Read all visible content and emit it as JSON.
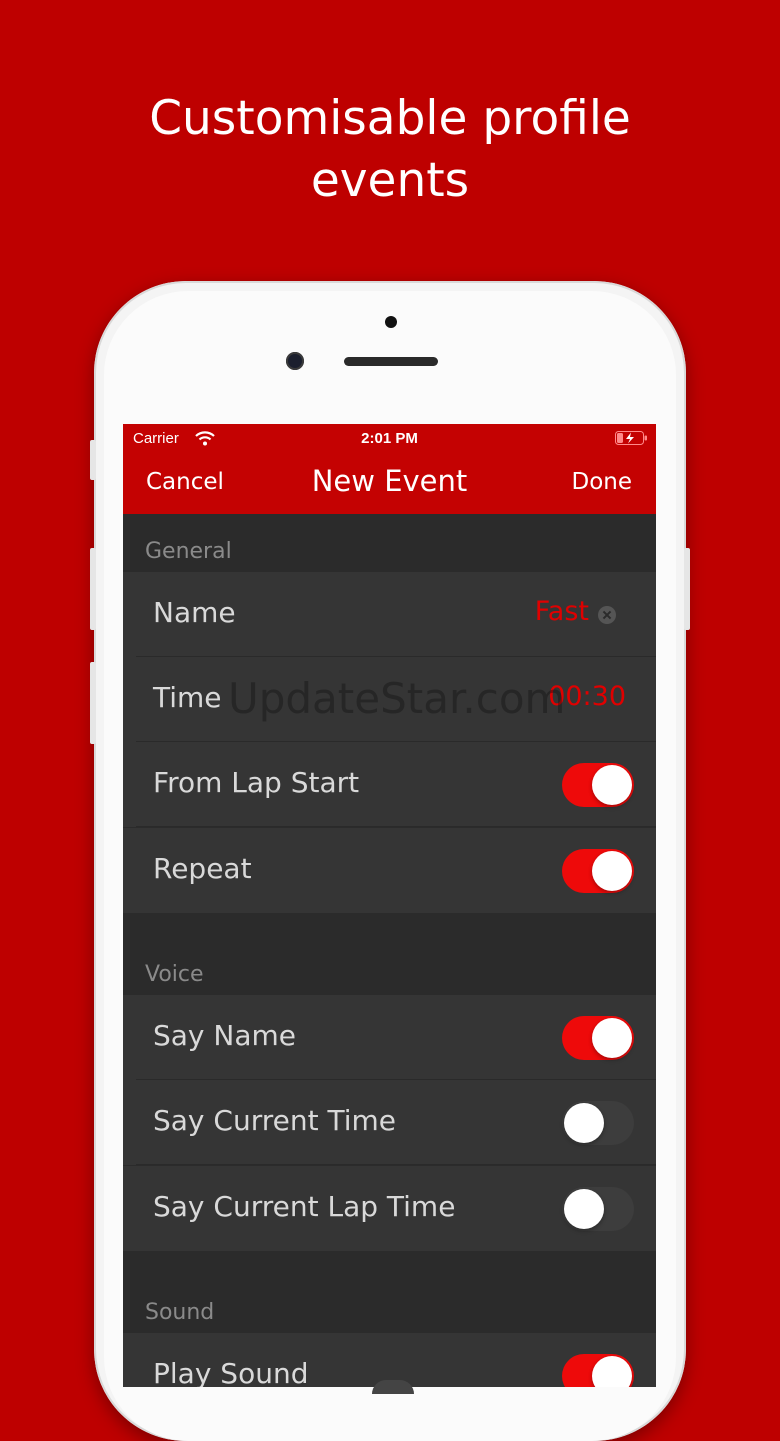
{
  "headline": {
    "line1": "Customisable profile",
    "line2": "events"
  },
  "status_bar": {
    "carrier": "Carrier",
    "time": "2:01 PM",
    "wifi_icon": "wifi-icon",
    "battery_icon": "battery-charging-icon"
  },
  "nav": {
    "cancel_label": "Cancel",
    "title": "New Event",
    "done_label": "Done"
  },
  "sections": {
    "general": "General",
    "voice": "Voice",
    "sound": "Sound"
  },
  "rows": {
    "name": {
      "label": "Name",
      "value": "Fast"
    },
    "time": {
      "label": "Time",
      "value": "00:30"
    },
    "from_lap_start": {
      "label": "From Lap Start",
      "on": true
    },
    "repeat": {
      "label": "Repeat",
      "on": true
    },
    "say_name": {
      "label": "Say Name",
      "on": true
    },
    "say_current_time": {
      "label": "Say Current Time",
      "on": false
    },
    "say_current_lap_time": {
      "label": "Say Current Lap Time",
      "on": false
    },
    "play_sound": {
      "label": "Play Sound",
      "on": true
    }
  },
  "watermark": "UpdateStar.com",
  "colors": {
    "background": "#be0000",
    "navbar": "#c40202",
    "accent": "#ee0a0a",
    "cell": "#353535",
    "table": "#2b2b2b"
  }
}
